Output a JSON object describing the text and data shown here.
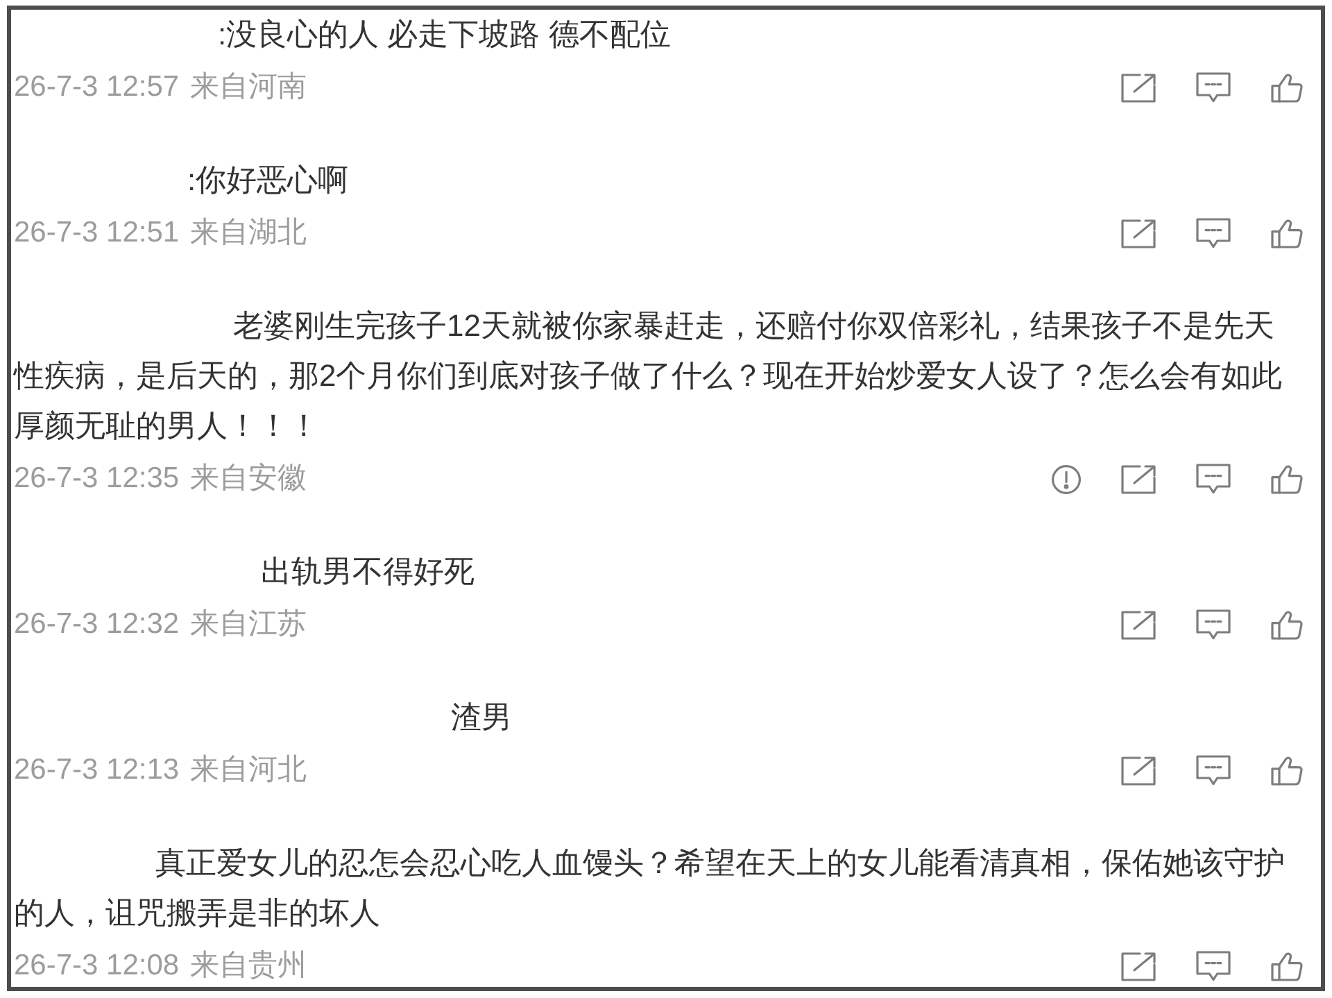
{
  "comments": [
    {
      "text": ":没良心的人 必走下坡路 德不配位",
      "time": "26-7-3 12:57",
      "location": "来自河南",
      "report_button": false
    },
    {
      "text": ":你好恶心啊",
      "time": "26-7-3 12:51",
      "location": "来自湖北",
      "report_button": false
    },
    {
      "text": "老婆刚生完孩子12天就被你家暴赶走，还赔付你双倍彩礼，结果孩子不是先天性疾病，是后天的，那2个月你们到底对孩子做了什么？现在开始炒爱女人设了？怎么会有如此厚颜无耻的男人！！！",
      "time": "26-7-3 12:35",
      "location": "来自安徽",
      "report_button": true
    },
    {
      "text": "出轨男不得好死",
      "time": "26-7-3 12:32",
      "location": "来自江苏",
      "report_button": false
    },
    {
      "text": "渣男",
      "time": "26-7-3 12:13",
      "location": "来自河北",
      "report_button": false
    },
    {
      "text": "真正爱女儿的忍怎会忍心吃人血馒头？希望在天上的女儿能看清真相，保佑她该守护的人，诅咒搬弄是非的坏人",
      "time": "26-7-3 12:08",
      "location": "来自贵州",
      "report_button": false
    }
  ]
}
